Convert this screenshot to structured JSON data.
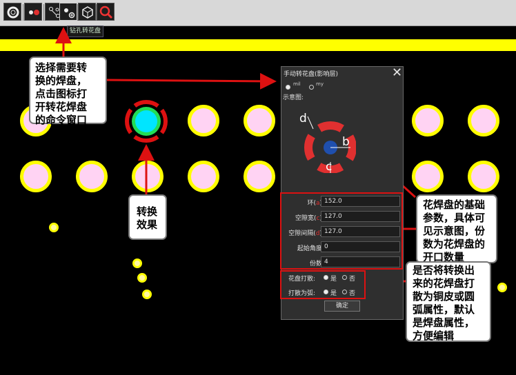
{
  "toolbar": {
    "buttons": [
      {
        "icon": "lifebuoy-icon"
      },
      {
        "icon": "record-dots-icon"
      },
      {
        "icon": "route-nodes-icon"
      },
      {
        "icon": "drill-thermal-icon"
      },
      {
        "icon": "package-cube-icon"
      },
      {
        "icon": "magnifier-icon"
      }
    ],
    "tooltip": "钻孔转花盘"
  },
  "callouts": {
    "select": [
      "选择需要转",
      "换的焊盘，",
      "点击图标打",
      "开转花焊盘",
      "的命令窗口"
    ],
    "effect": [
      "转换",
      "效果"
    ],
    "params": [
      "花焊盘的基础",
      "参数，具体可",
      "见示意图，份",
      "数为花焊盘的",
      "开口数量"
    ],
    "scatter": [
      "是否将转换出",
      "来的花焊盘打",
      "散为铜皮或圆",
      "弧属性，默认",
      "是焊盘属性，",
      "方便编辑"
    ]
  },
  "dialog": {
    "title": "手动转花盘(影响层)",
    "close": "✕",
    "unit_options": [
      "mil",
      "my"
    ],
    "unit_selected": "mil",
    "preview_label": "示意图:",
    "diagram_labels": {
      "d": "d",
      "b": "b",
      "c": "c"
    },
    "fields": [
      {
        "label_pre": "环(",
        "label_key": "a",
        "label_post": ")",
        "value": "152.0"
      },
      {
        "label_pre": "空隙宽(",
        "label_key": "c",
        "label_post": ")",
        "value": "127.0"
      },
      {
        "label_pre": "空隙间隔(",
        "label_key": "d",
        "label_post": ")",
        "value": "127.0"
      },
      {
        "label_pre": "起始角度",
        "label_key": "",
        "label_post": "",
        "value": "0"
      },
      {
        "label_pre": "份数",
        "label_key": "",
        "label_post": "",
        "value": "4"
      }
    ],
    "scatter_pad": {
      "label": "花盘打散:",
      "yes": "是",
      "no": "否",
      "selected": "yes"
    },
    "scatter_arc": {
      "label": "打散为弧:",
      "yes": "是",
      "no": "否",
      "selected": "yes"
    },
    "ok": "确定"
  },
  "colors": {
    "board": "#000000",
    "copper_band": "#ffff00",
    "pad_fill": "#ffd3f3",
    "highlight": "#dd1111",
    "thermal_ring": "#e03030",
    "thermal_core": "#00e5ff",
    "thermal_halo": "#22dd55"
  }
}
